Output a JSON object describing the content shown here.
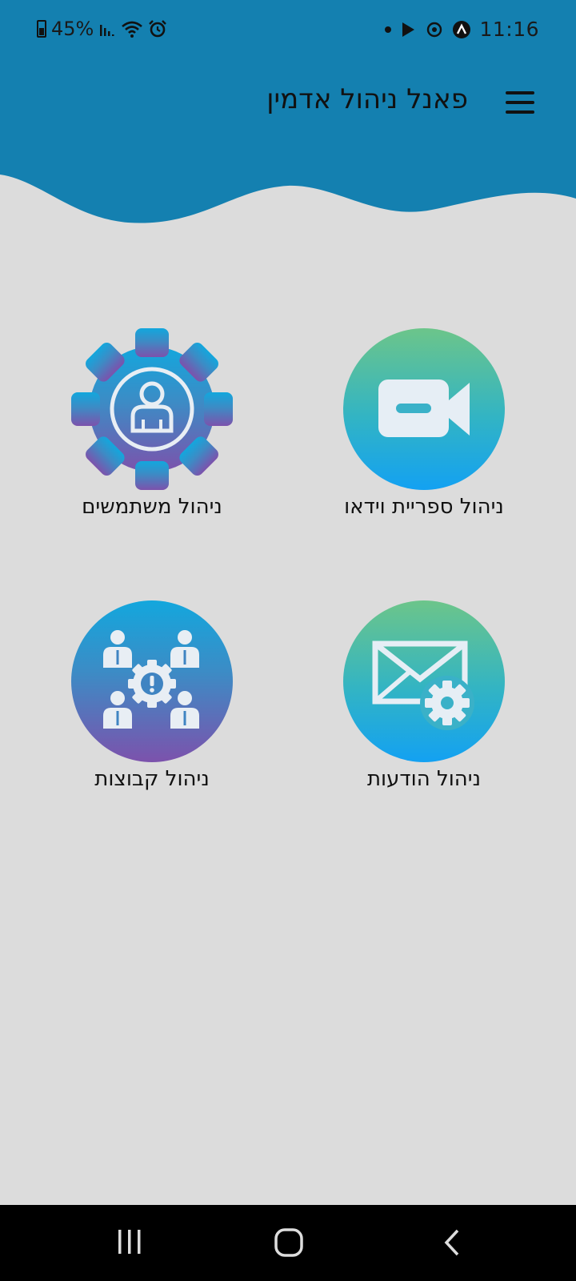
{
  "status_bar": {
    "battery": "45%",
    "time": "11:16"
  },
  "header": {
    "title": "פאנל ניהול אדמין",
    "bg_color": "#1480b0"
  },
  "tiles": [
    {
      "label": "ניהול ספריית וידאו",
      "icon": "video-camera-icon"
    },
    {
      "label": "ניהול משתמשים",
      "icon": "user-gear-icon"
    },
    {
      "label": "ניהול הודעות",
      "icon": "envelope-gear-icon"
    },
    {
      "label": "ניהול קבוצות",
      "icon": "group-gear-icon"
    }
  ],
  "nav_bar": {
    "buttons": [
      "recent-apps",
      "home",
      "back"
    ]
  }
}
